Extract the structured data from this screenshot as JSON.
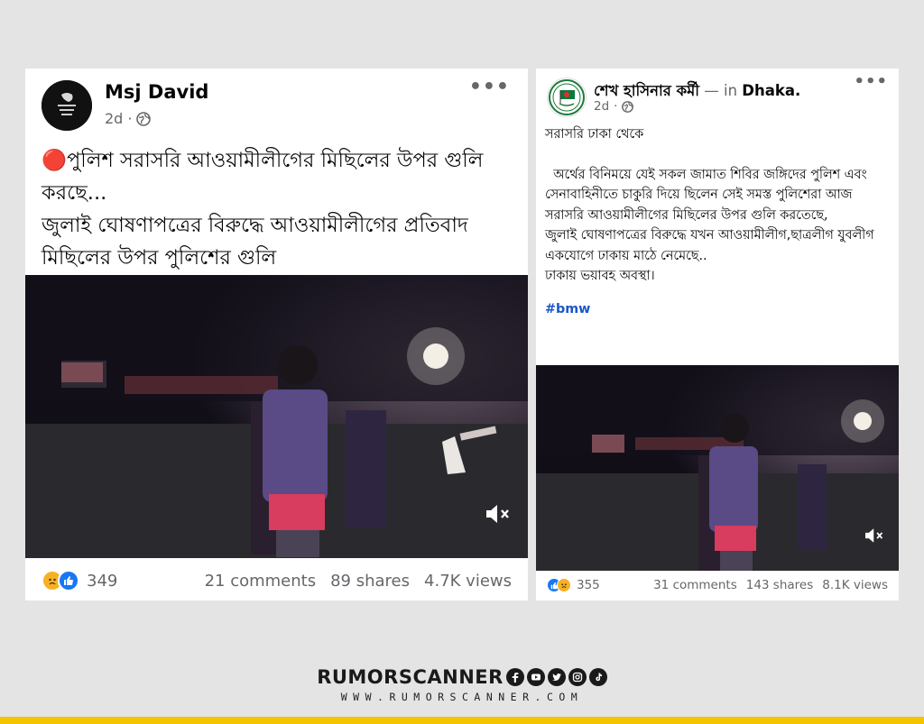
{
  "post_left": {
    "author": "Msj David",
    "time": "2d",
    "privacy_icon": "globe-icon",
    "lines": [
      "🔴পুলিশ সরাসরি আওয়ামীলীগের মিছিলের উপর গুলি করছে...",
      "জুলাই ঘোষণাপত্রের বিরুদ্ধে আওয়ামীলীগের প্রতিবাদ মিছিলের উপর পুলিশের গুলি"
    ],
    "reactions": "349",
    "comments": "21 comments",
    "shares": "89 shares",
    "views": "4.7K views"
  },
  "post_right": {
    "author": "শেখ হাসিনার কর্মী",
    "separator": " — in ",
    "location": "Dhaka",
    "location_suffix": ".",
    "time": "2d",
    "privacy_icon": "globe-icon",
    "lines": [
      "সরাসরি ঢাকা থেকে",
      "  অর্থের বিনিময়ে যেই সকল জামাত শিবির জঙ্গিদের পুলিশ এবং সেনাবাহিনীতে চাকুরি দিয়ে ছিলেন সেই সমস্ত পুলিশেরা আজ সরাসরি আওয়ামীলীগের মিছিলের উপর গুলি করতেছে,",
      "জুলাই ঘোষণাপত্রের বিরুদ্ধে যখন আওয়ামীলীগ,ছাত্রলীগ যুবলীগ একযোগে ঢাকায় মাঠে নেমেছে..",
      "ঢাকায় ভয়াবহ অবস্থা।"
    ],
    "hashtag": "#bmw",
    "reactions": "355",
    "comments": "31 comments",
    "shares": "143 shares",
    "views": "8.1K views"
  },
  "footer": {
    "brand": "RUMORSCANNER",
    "url": "WWW.RUMORSCANNER.COM",
    "social_icons": [
      "facebook-icon",
      "youtube-icon",
      "twitter-icon",
      "instagram-icon",
      "tiktok-icon"
    ],
    "accent_color": "#f5c400"
  }
}
